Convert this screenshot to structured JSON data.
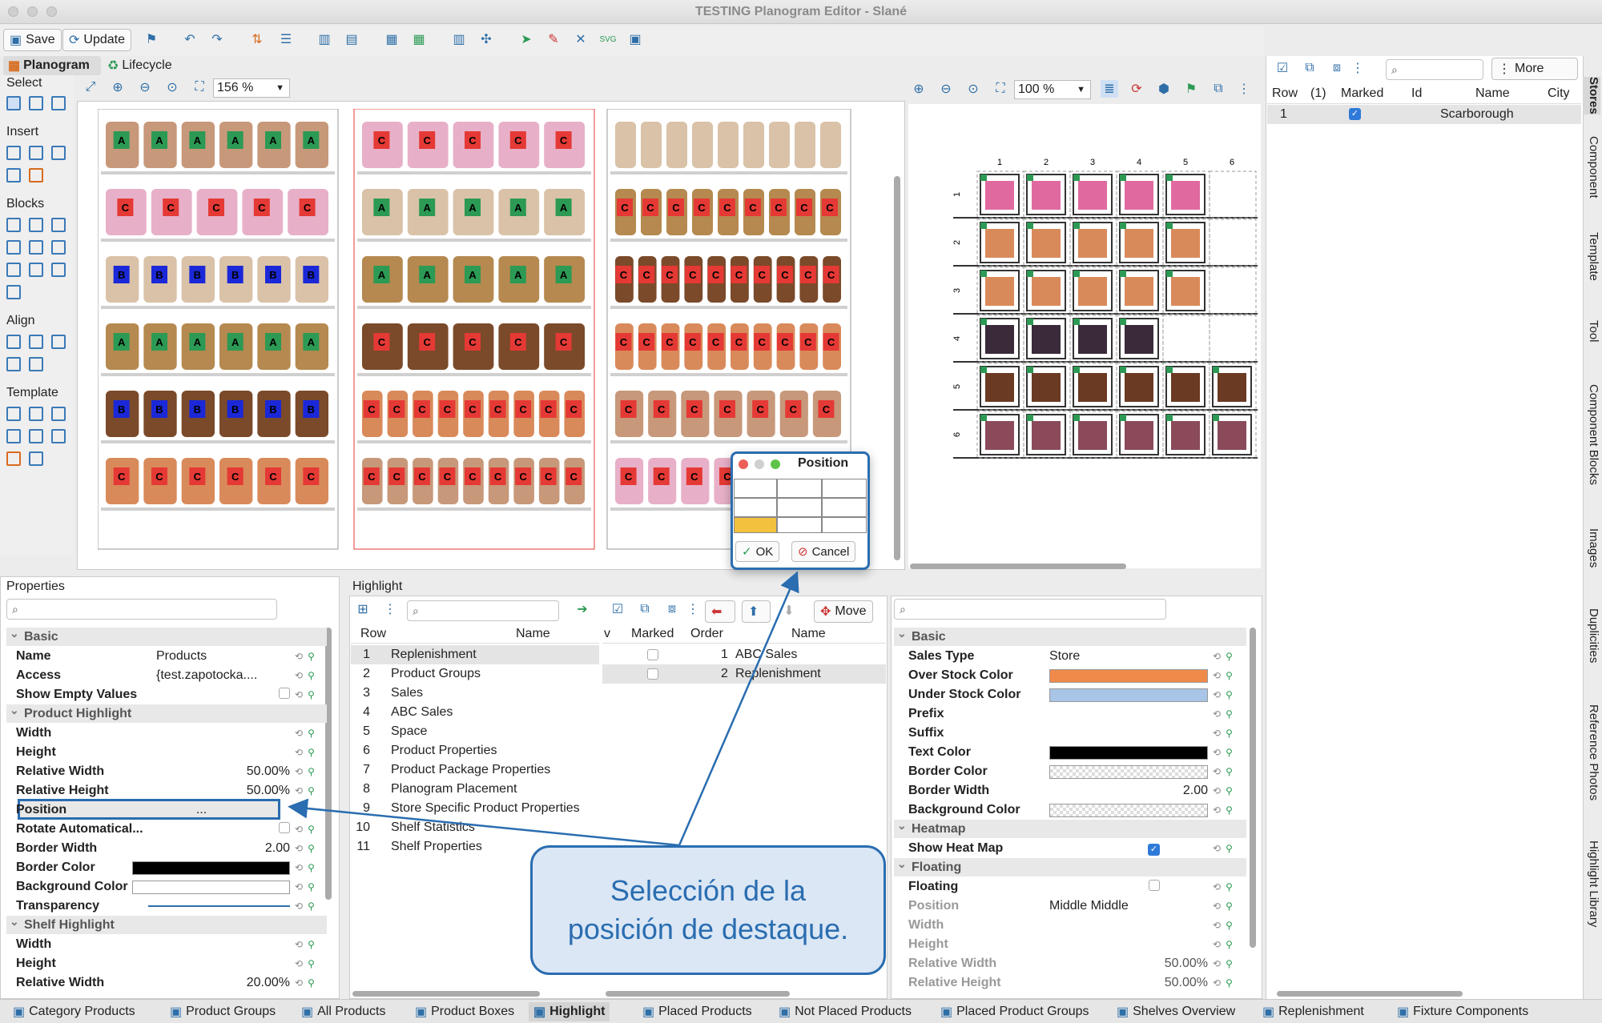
{
  "window": {
    "title": "TESTING Planogram Editor - Slané"
  },
  "toolbar": {
    "save": "Save",
    "update": "Update"
  },
  "tabs": {
    "planogram": "Planogram",
    "lifecycle": "Lifecycle"
  },
  "palette": {
    "select": "Select",
    "insert": "Insert",
    "blocks": "Blocks",
    "align": "Align",
    "template": "Template"
  },
  "zoom": {
    "left": "156 %",
    "right": "100 %"
  },
  "stores": {
    "more": "More",
    "headers": [
      "Row",
      "(1)",
      "Marked",
      "Id",
      "Name",
      "City"
    ],
    "rows": [
      {
        "row": "1",
        "marked": true,
        "name": "Scarborough"
      }
    ]
  },
  "side_tabs": [
    "Stores",
    "Component",
    "Template",
    "Tool",
    "Component Blocks",
    "Images",
    "Duplicities",
    "Reference Photos",
    "Highlight Library"
  ],
  "properties": {
    "title": "Properties",
    "sections": {
      "basic": "Basic",
      "product_highlight": "Product Highlight",
      "shelf_highlight": "Shelf Highlight"
    },
    "name": {
      "k": "Name",
      "v": "Products"
    },
    "access": {
      "k": "Access",
      "v": "{test.zapotocka...."
    },
    "show_empty": {
      "k": "Show Empty Values"
    },
    "width": {
      "k": "Width"
    },
    "height": {
      "k": "Height"
    },
    "rel_width": {
      "k": "Relative Width",
      "v": "50.00%"
    },
    "rel_height": {
      "k": "Relative Height",
      "v": "50.00%"
    },
    "position": {
      "k": "Position",
      "v": "..."
    },
    "rotate": {
      "k": "Rotate Automatical..."
    },
    "border_width": {
      "k": "Border Width",
      "v": "2.00"
    },
    "border_color": {
      "k": "Border Color"
    },
    "bg_color": {
      "k": "Background Color"
    },
    "transparency": {
      "k": "Transparency"
    },
    "shelf_width": {
      "k": "Width"
    },
    "shelf_height": {
      "k": "Height"
    },
    "shelf_rel_width": {
      "k": "Relative Width",
      "v": "20.00%"
    }
  },
  "highlight": {
    "title": "Highlight",
    "col_row": "Row",
    "col_name": "Name",
    "items": [
      [
        "1",
        "Replenishment"
      ],
      [
        "2",
        "Product Groups"
      ],
      [
        "3",
        "Sales"
      ],
      [
        "4",
        "ABC Sales"
      ],
      [
        "5",
        "Space"
      ],
      [
        "6",
        "Product Properties"
      ],
      [
        "7",
        "Product Package Properties"
      ],
      [
        "8",
        "Planogram Placement"
      ],
      [
        "9",
        "Store Specific Product Properties"
      ],
      [
        "10",
        "Shelf Statistics"
      ],
      [
        "11",
        "Shelf Properties"
      ]
    ]
  },
  "selected": {
    "move": "Move",
    "headers": [
      "v",
      "Marked",
      "Order",
      "Name"
    ],
    "rows": [
      [
        "1",
        "ABC Sales"
      ],
      [
        "2",
        "Replenishment"
      ]
    ]
  },
  "detail": {
    "basic": "Basic",
    "heatmap": "Heatmap",
    "floating_sec": "Floating",
    "sales_type": {
      "k": "Sales Type",
      "v": "Store"
    },
    "over": {
      "k": "Over Stock Color",
      "color": "#f08a4b"
    },
    "under": {
      "k": "Under Stock Color",
      "color": "#a8c4e6"
    },
    "prefix": {
      "k": "Prefix"
    },
    "suffix": {
      "k": "Suffix"
    },
    "text_color": {
      "k": "Text Color"
    },
    "border_color": {
      "k": "Border Color"
    },
    "border_width": {
      "k": "Border Width",
      "v": "2.00"
    },
    "bg_color": {
      "k": "Background Color"
    },
    "show_heat": {
      "k": "Show Heat Map"
    },
    "floating": {
      "k": "Floating"
    },
    "position": {
      "k": "Position",
      "v": "Middle Middle"
    },
    "width": {
      "k": "Width"
    },
    "height": {
      "k": "Height"
    },
    "rel_width": {
      "k": "Relative Width",
      "v": "50.00%"
    },
    "rel_height": {
      "k": "Relative Height",
      "v": "50.00%"
    }
  },
  "dialog": {
    "title": "Position",
    "ok": "OK",
    "cancel": "Cancel"
  },
  "callout": {
    "line1": "Selección de la",
    "line2": "posición de destaque."
  },
  "grid_cols": [
    "1",
    "2",
    "3",
    "4",
    "5",
    "6"
  ],
  "grid_rows": [
    "1",
    "2",
    "3",
    "4",
    "5",
    "6"
  ],
  "bottom_tabs": [
    "Category Products",
    "Product Groups",
    "All Products",
    "Product Boxes",
    "Highlight",
    "Placed Products",
    "Not Placed Products",
    "Placed Product Groups",
    "Shelves Overview",
    "Replenishment",
    "Fixture Components"
  ]
}
